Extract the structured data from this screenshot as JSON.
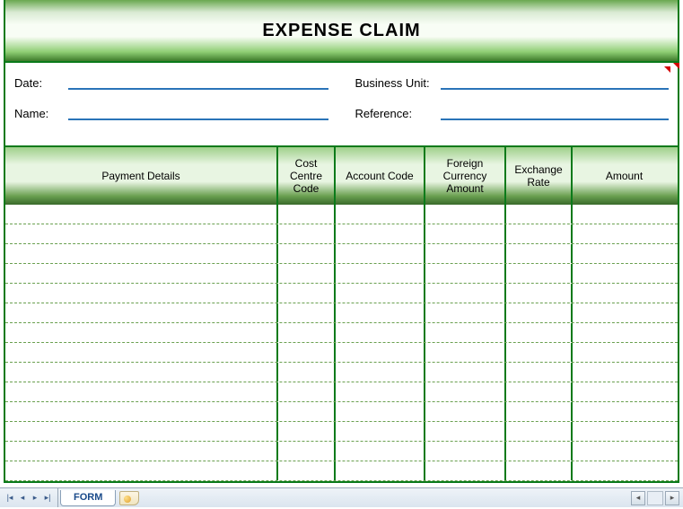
{
  "title": "EXPENSE CLAIM",
  "info": {
    "date_label": "Date:",
    "name_label": "Name:",
    "business_unit_label": "Business Unit:",
    "reference_label": "Reference:",
    "date_value": "",
    "name_value": "",
    "business_unit_value": "",
    "reference_value": ""
  },
  "columns": {
    "details": "Payment Details",
    "cost": "Cost Centre Code",
    "account": "Account Code",
    "foreign": "Foreign Currency Amount",
    "exchange": "Exchange Rate",
    "amount": "Amount"
  },
  "rows": [
    {
      "details": "",
      "cost": "",
      "account": "",
      "foreign": "",
      "exchange": "",
      "amount": ""
    },
    {
      "details": "",
      "cost": "",
      "account": "",
      "foreign": "",
      "exchange": "",
      "amount": ""
    },
    {
      "details": "",
      "cost": "",
      "account": "",
      "foreign": "",
      "exchange": "",
      "amount": ""
    },
    {
      "details": "",
      "cost": "",
      "account": "",
      "foreign": "",
      "exchange": "",
      "amount": ""
    },
    {
      "details": "",
      "cost": "",
      "account": "",
      "foreign": "",
      "exchange": "",
      "amount": ""
    },
    {
      "details": "",
      "cost": "",
      "account": "",
      "foreign": "",
      "exchange": "",
      "amount": ""
    },
    {
      "details": "",
      "cost": "",
      "account": "",
      "foreign": "",
      "exchange": "",
      "amount": ""
    },
    {
      "details": "",
      "cost": "",
      "account": "",
      "foreign": "",
      "exchange": "",
      "amount": ""
    },
    {
      "details": "",
      "cost": "",
      "account": "",
      "foreign": "",
      "exchange": "",
      "amount": ""
    },
    {
      "details": "",
      "cost": "",
      "account": "",
      "foreign": "",
      "exchange": "",
      "amount": ""
    },
    {
      "details": "",
      "cost": "",
      "account": "",
      "foreign": "",
      "exchange": "",
      "amount": ""
    },
    {
      "details": "",
      "cost": "",
      "account": "",
      "foreign": "",
      "exchange": "",
      "amount": ""
    },
    {
      "details": "",
      "cost": "",
      "account": "",
      "foreign": "",
      "exchange": "",
      "amount": ""
    },
    {
      "details": "",
      "cost": "",
      "account": "",
      "foreign": "",
      "exchange": "",
      "amount": ""
    }
  ],
  "sheet": {
    "tab_name": "FORM"
  }
}
